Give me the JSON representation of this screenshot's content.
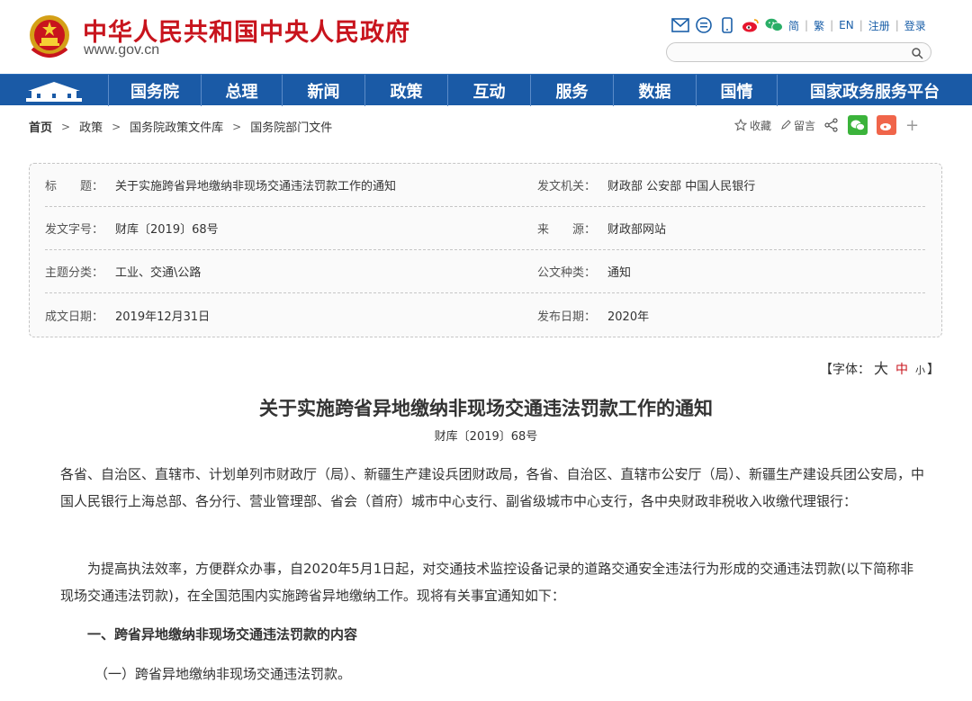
{
  "header": {
    "site_title": "中华人民共和国中央人民政府",
    "site_url": "www.gov.cn",
    "lang_links": [
      "简",
      "繁",
      "EN",
      "注册",
      "登录"
    ],
    "icons": [
      "mail-icon",
      "chat-icon",
      "phone-icon",
      "weibo-icon",
      "wechat-icon"
    ],
    "search_placeholder": ""
  },
  "nav": {
    "items": [
      {
        "label": "国务院",
        "width": 103
      },
      {
        "label": "总理",
        "width": 90
      },
      {
        "label": "新闻",
        "width": 92
      },
      {
        "label": "政策",
        "width": 92
      },
      {
        "label": "互动",
        "width": 92
      },
      {
        "label": "服务",
        "width": 92
      },
      {
        "label": "数据",
        "width": 92
      },
      {
        "label": "国情",
        "width": 90
      },
      {
        "label": "国家政务服务平台",
        "width": 215
      }
    ]
  },
  "breadcrumb": {
    "home": "首页",
    "items": [
      "政策",
      "国务院政策文件库",
      "国务院部门文件"
    ]
  },
  "tools": {
    "favorite": "收藏",
    "comment": "留言",
    "plus": "+"
  },
  "info": {
    "title_label": "标　　题：",
    "title_value": "关于实施跨省异地缴纳非现场交通违法罚款工作的通知",
    "issuer_label": "发文机关：",
    "issuer_value": "财政部 公安部 中国人民银行",
    "docno_label": "发文字号：",
    "docno_value": "财库〔2019〕68号",
    "source_label": "来　　源：",
    "source_value": "财政部网站",
    "topic_label": "主题分类：",
    "topic_value": "工业、交通\\公路",
    "type_label": "公文种类：",
    "type_value": "通知",
    "written_label": "成文日期：",
    "written_value": "2019年12月31日",
    "published_label": "发布日期：",
    "published_value": "2020年"
  },
  "fontsize": {
    "open": "【字体：",
    "big": "大",
    "mid": "中",
    "small": "小",
    "close": "】"
  },
  "article": {
    "title": "关于实施跨省异地缴纳非现场交通违法罚款工作的通知",
    "doc_no": "财库〔2019〕68号",
    "p1": "各省、自治区、直辖市、计划单列市财政厅（局）、新疆生产建设兵团财政局，各省、自治区、直辖市公安厅（局）、新疆生产建设兵团公安局，中国人民银行上海总部、各分行、营业管理部、省会（首府）城市中心支行、副省级城市中心支行，各中央财政非税收入收缴代理银行：",
    "p2": "为提高执法效率，方便群众办事，自2020年5月1日起，对交通技术监控设备记录的道路交通安全违法行为形成的交通违法罚款(以下简称非现场交通违法罚款)，在全国范围内实施跨省异地缴纳工作。现将有关事宜通知如下：",
    "heading1": "一、跨省异地缴纳非现场交通违法罚款的内容",
    "sub1": "（一）跨省异地缴纳非现场交通违法罚款。"
  },
  "colors": {
    "brand_red": "#c8141d",
    "nav_blue": "#1a5aa6",
    "link_blue": "#1a5fa8"
  }
}
